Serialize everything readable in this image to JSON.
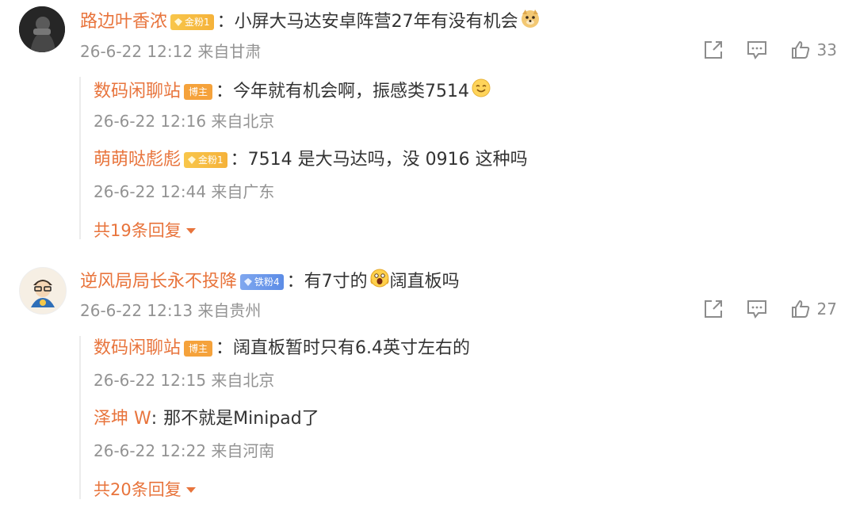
{
  "threads": [
    {
      "author": "路边叶香浓",
      "badge": "金粉1",
      "text": "小屏大马达安卓阵营27年有没有机会",
      "emoji": "doge-icon",
      "time": "26-6-22 12:12 来自甘肃",
      "likes": "33",
      "replies": [
        {
          "author": "数码闲聊站",
          "badge": "博主",
          "badge_type": "host",
          "text": "今年就有机会啊，振感类7514",
          "emoji": "smile-icon",
          "time": "26-6-22 12:16 来自北京"
        },
        {
          "author": "萌萌哒彪彪",
          "badge": "金粉1",
          "badge_type": "gold",
          "text": "7514 是大马达吗，没 0916 这种吗",
          "emoji": "",
          "time": "26-6-22 12:44 来自广东"
        }
      ],
      "more": "共19条回复"
    },
    {
      "author": "逆风局局长永不投降",
      "badge": "铁粉4",
      "text_before": "有7寸的",
      "text_after": "阔直板吗",
      "emoji": "shocked-icon",
      "time": "26-6-22 12:13 来自贵州",
      "likes": "27",
      "replies": [
        {
          "author": "数码闲聊站",
          "badge": "博主",
          "badge_type": "host",
          "text": "阔直板暂时只有6.4英寸左右的",
          "time": "26-6-22 12:15 来自北京"
        },
        {
          "author": "泽坤 W",
          "badge": "",
          "badge_type": "",
          "text": "那不就是Minipad了",
          "time": "26-6-22 12:22 来自河南"
        }
      ],
      "more": "共20条回复"
    }
  ],
  "colors": {
    "name": "#e8743c",
    "text": "#333333",
    "time": "#939393",
    "gold_badge": "#f5b23a",
    "iron_badge": "#5c8ce6",
    "host_badge": "#f5a23b"
  },
  "icons": {
    "share": "share-icon",
    "comment": "comment-icon",
    "like": "thumbs-up-icon"
  }
}
